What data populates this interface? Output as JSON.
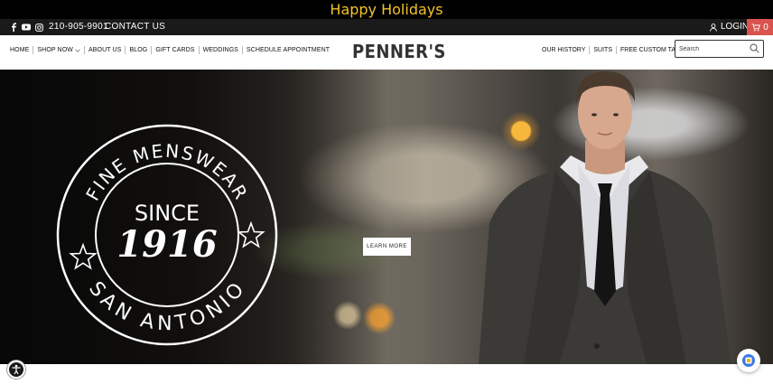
{
  "announcement": {
    "text": "Happy Holidays"
  },
  "utility": {
    "social_icons": [
      "facebook-icon",
      "youtube-icon",
      "instagram-icon"
    ],
    "phone": "210-905-9901",
    "contact": "CONTACT US",
    "login": "LOGIN",
    "cart_count": "0"
  },
  "nav": {
    "left": [
      "HOME",
      "SHOP NOW",
      "ABOUT US",
      "BLOG",
      "GIFT CARDS",
      "WEDDINGS",
      "SCHEDULE APPOINTMENT"
    ],
    "logo": "PENNER'S",
    "right": [
      "OUR HISTORY",
      "SUITS",
      "FREE CUSTOM TAILORING"
    ],
    "search_placeholder": "Search"
  },
  "hero": {
    "badge_top": "FINE MENSWEAR",
    "badge_since": "SINCE",
    "badge_year": "1916",
    "badge_bottom": "SAN ANTONIO",
    "cta": "LEARN MORE"
  },
  "colors": {
    "announce_text": "#f2c32a",
    "cart_bg": "#d9534f",
    "utility_bg": "#1a1a1a"
  }
}
